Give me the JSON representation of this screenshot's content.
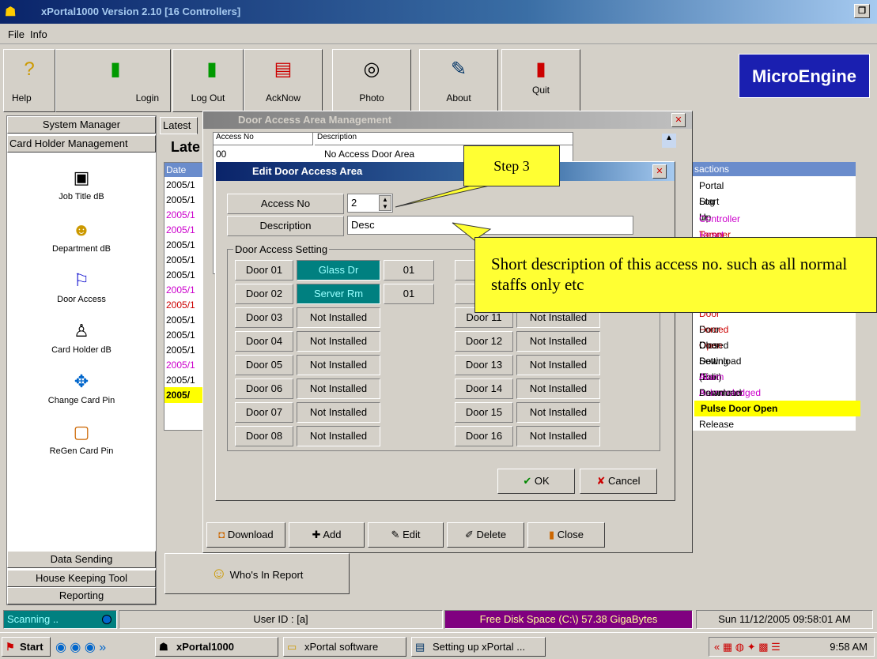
{
  "window": {
    "title": "xPortal1000 Version 2.10 [16 Controllers]"
  },
  "menu": {
    "file": "File",
    "info": "Info"
  },
  "toolbar": {
    "help": "Help",
    "login": "Login",
    "logout": "Log Out",
    "acknow": "AckNow",
    "photo": "Photo",
    "about": "About",
    "quit": "Quit"
  },
  "logo": "MicroEngine",
  "sidebar": {
    "system_manager": "System Manager",
    "card_holder_mgmt": "Card Holder Management",
    "items": [
      "Job Title dB",
      "Department dB",
      "Door Access",
      "Card Holder dB",
      "Change Card Pin",
      "ReGen Card Pin"
    ],
    "data_sending": "Data Sending",
    "house_keeping": "House Keeping Tool",
    "reporting": "Reporting"
  },
  "main": {
    "tab": "Latest",
    "heading": "Late",
    "date_header": "Date",
    "dates": [
      "2005/1",
      "2005/1",
      "2005/1",
      "2005/1",
      "2005/1",
      "2005/1",
      "2005/1",
      "2005/1",
      "2005/1",
      "2005/1",
      "2005/1",
      "2005/1",
      "2005/1",
      "2005/1",
      "2005/"
    ],
    "transactions_header": "sactions",
    "transactions": [
      "Portal Start Up",
      "Log In",
      "Controller Reset",
      "Tamper On",
      "Door Forced Open",
      "Door Closed",
      "Door Setting (Edit)",
      "Download Door Parameter",
      "Alarm Acknowledged",
      "Download Door Release",
      "Pulse Door Open"
    ],
    "whos_in": "Who's In Report"
  },
  "door_area_window": {
    "title": "Door Access Area Management",
    "col_access": "Access No",
    "col_desc": "Description",
    "row_no": "00",
    "row_desc": "No Access Door Area",
    "buttons": {
      "download": "Download",
      "add": "Add",
      "edit": "Edit",
      "delete": "Delete",
      "close": "Close"
    }
  },
  "edit_dialog": {
    "title": "Edit Door Access Area",
    "access_no_label": "Access No",
    "access_no_value": "2",
    "description_label": "Description",
    "description_value": "Desc",
    "group_label": "Door Access Setting",
    "doors_left": [
      {
        "door": "Door 01",
        "name": "Glass Dr",
        "code": "01"
      },
      {
        "door": "Door 02",
        "name": "Server Rm",
        "code": "01"
      },
      {
        "door": "Door 03",
        "name": "Not Installed"
      },
      {
        "door": "Door 04",
        "name": "Not Installed"
      },
      {
        "door": "Door 05",
        "name": "Not Installed"
      },
      {
        "door": "Door 06",
        "name": "Not Installed"
      },
      {
        "door": "Door 07",
        "name": "Not Installed"
      },
      {
        "door": "Door 08",
        "name": "Not Installed"
      }
    ],
    "doors_right": [
      {
        "door": "Do",
        "name": ""
      },
      {
        "door": "Do",
        "name": ""
      },
      {
        "door": "Door 11",
        "name": "Not Installed"
      },
      {
        "door": "Door 12",
        "name": "Not Installed"
      },
      {
        "door": "Door 13",
        "name": "Not Installed"
      },
      {
        "door": "Door 14",
        "name": "Not Installed"
      },
      {
        "door": "Door 15",
        "name": "Not Installed"
      },
      {
        "door": "Door 16",
        "name": "Not Installed"
      }
    ],
    "ok": "OK",
    "cancel": "Cancel"
  },
  "callouts": {
    "step": "Step 3",
    "desc": "Short description of this access no. such as all normal staffs only etc"
  },
  "status": {
    "scanning": "Scanning ..",
    "user": "User ID : [a]",
    "disk": "Free Disk Space (C:\\) 57.38  GigaBytes",
    "datetime": "Sun 11/12/2005 09:58:01 AM"
  },
  "taskbar": {
    "start": "Start",
    "t1": "xPortal1000",
    "t2": "xPortal software",
    "t3": "Setting up xPortal ...",
    "clock": "9:58 AM"
  }
}
